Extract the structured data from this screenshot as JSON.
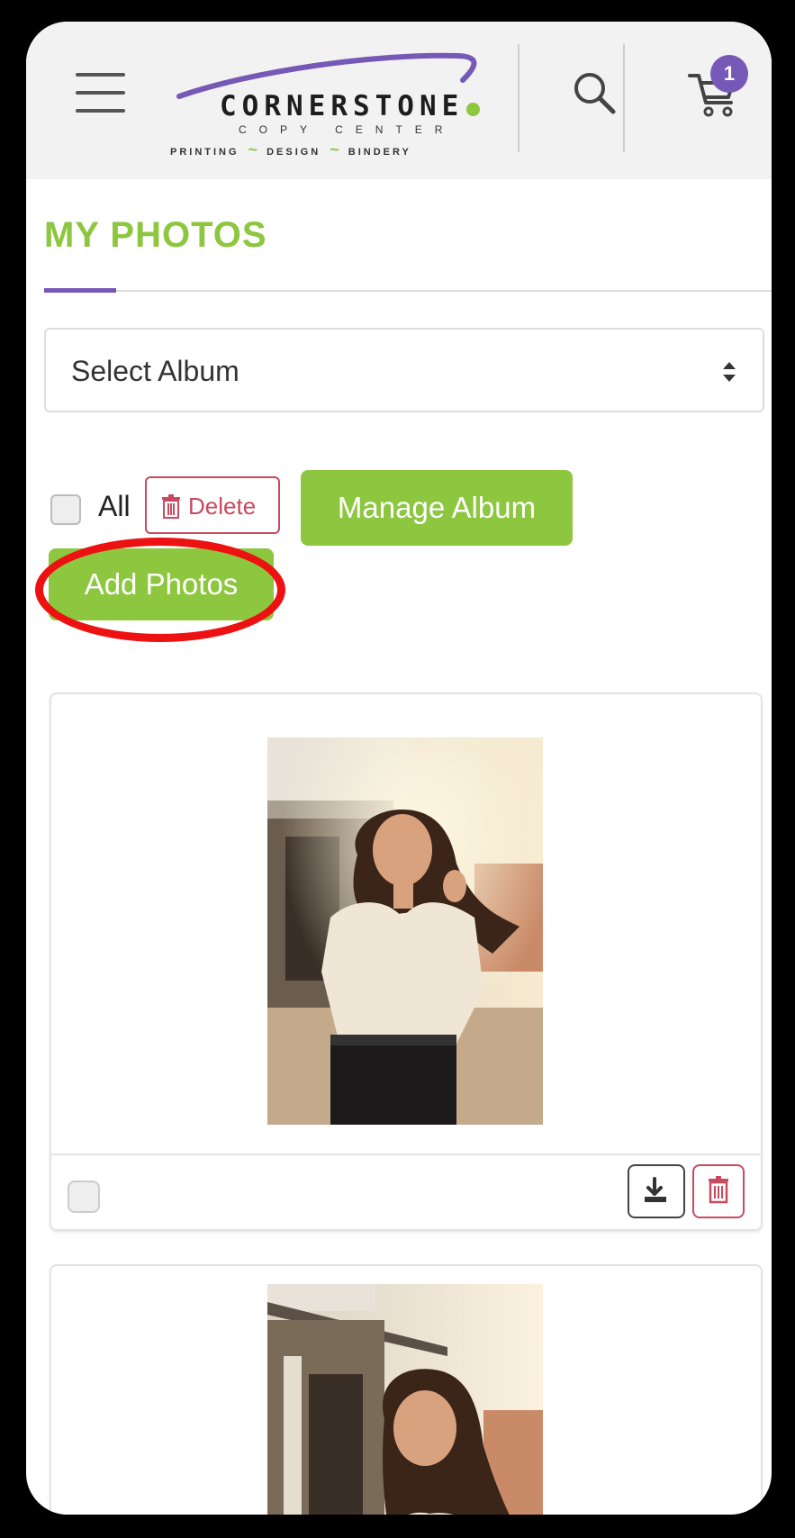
{
  "header": {
    "logo": {
      "name": "CORNERSTONE",
      "sub": "COPY CENTER",
      "tagline": [
        "PRINTING",
        "DESIGN",
        "BINDERY"
      ]
    },
    "menu_icon": "hamburger-icon",
    "search_icon": "search-icon",
    "cart_icon": "cart-icon",
    "cart_count": "1"
  },
  "page": {
    "title": "MY PHOTOS"
  },
  "album_select": {
    "value": "Select Album"
  },
  "toolbar": {
    "all_label": "All",
    "delete_label": "Delete",
    "manage_label": "Manage Album",
    "add_label": "Add Photos"
  },
  "colors": {
    "brand_green": "#8dc63f",
    "brand_purple": "#7658b6",
    "danger": "#c94a5f",
    "highlight": "#ee1111"
  }
}
